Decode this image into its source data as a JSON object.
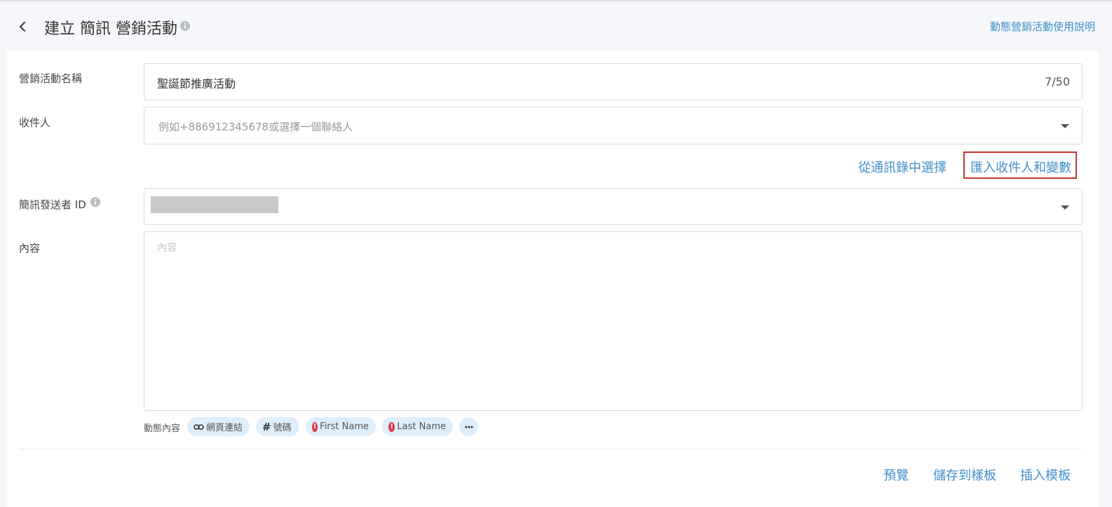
{
  "header": {
    "title": "建立 簡訊 營銷活動",
    "help_link": "動態營銷活動使用說明"
  },
  "form": {
    "campaign_name": {
      "label": "營銷活動名稱",
      "value": "聖誕節推廣活動",
      "counter": "7/50"
    },
    "recipients": {
      "label": "收件人",
      "placeholder": "例如+886912345678或選擇一個聯絡人",
      "choose_from_contacts": "從通訊錄中選擇",
      "import_recipients": "匯入收件人和變數"
    },
    "sender_id": {
      "label": "簡訊發送者 ID"
    },
    "content": {
      "label": "內容",
      "placeholder": "內容"
    },
    "dynamic_content": {
      "label": "動態內容",
      "chips": [
        "網頁連結",
        "號碼",
        "First Name",
        "Last Name"
      ]
    }
  },
  "footer": {
    "preview": "預覽",
    "save_template": "儲存到樣板",
    "insert_template": "插入模板"
  },
  "colors": {
    "accent": "#3f8fc9",
    "highlight": "#c0392b",
    "chip_bg": "#deeefa",
    "alert": "#d9384a"
  }
}
